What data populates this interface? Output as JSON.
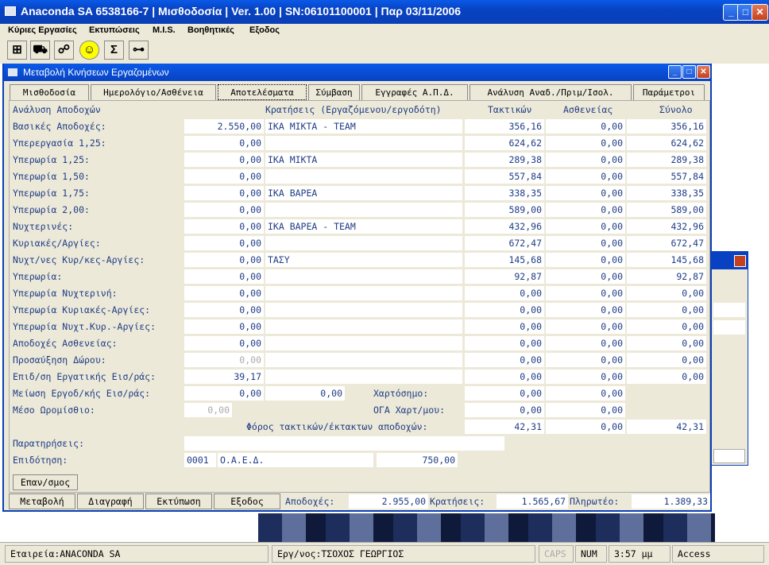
{
  "app": {
    "title": "Anaconda SA 6538166-7 | Μισθοδοσία | Ver. 1.00 | SN:06101100001 | Παρ 03/11/2006",
    "menu": [
      "Κύριες Εργασίες",
      "Εκτυπώσεις",
      "M.I.S.",
      "Βοηθητικές",
      "Εξοδος"
    ],
    "toolbar_icons": [
      "network-icon",
      "car-icon",
      "org-chart-icon",
      "smiley-icon",
      "sigma-icon",
      "key-icon"
    ],
    "toolbar_glyphs": [
      "⊞",
      "⛟",
      "☍",
      "☺",
      "Σ",
      "⊶"
    ]
  },
  "child": {
    "title": "Μεταβολή Κινήσεων Εργαζομένων",
    "tabs": [
      "Μισθοδοσία",
      "Ημερολόγιο/Ασθένεια",
      "Αποτελέσματα",
      "Σύμβαση",
      "Εγγραφές Α.Π.Δ.",
      "Ανάλυση Αναδ./Πριμ/Ισολ.",
      "Παράμετροι"
    ],
    "active_tab": "Αποτελέσματα",
    "headers": {
      "analysis": "Ανάλυση Αποδοχών",
      "deductions": "Κρατήσεις (Εργαζόμενου/εργοδότη)",
      "regular": "Τακτικών",
      "sickness": "Ασθενείας",
      "total": "Σύνολο"
    },
    "rows": [
      {
        "label": "Βασικές Αποδοχές:",
        "value": "2.550,00",
        "ded": "ΙΚΑ ΜΙΚΤΑ - TEAM",
        "reg": "356,16",
        "sick": "0,00",
        "tot": "356,16"
      },
      {
        "label": "Υπερεργασία 1,25:",
        "value": "0,00",
        "ded": "",
        "reg": "624,62",
        "sick": "0,00",
        "tot": "624,62"
      },
      {
        "label": "Υπερωρία 1,25:",
        "value": "0,00",
        "ded": "ΙΚΑ ΜΙΚΤΑ",
        "reg": "289,38",
        "sick": "0,00",
        "tot": "289,38"
      },
      {
        "label": "Υπερωρία 1,50:",
        "value": "0,00",
        "ded": "",
        "reg": "557,84",
        "sick": "0,00",
        "tot": "557,84"
      },
      {
        "label": "Υπερωρία 1,75:",
        "value": "0,00",
        "ded": "ΙΚΑ ΒΑΡΕΑ",
        "reg": "338,35",
        "sick": "0,00",
        "tot": "338,35"
      },
      {
        "label": "Υπερωρία 2,00:",
        "value": "0,00",
        "ded": "",
        "reg": "589,00",
        "sick": "0,00",
        "tot": "589,00"
      },
      {
        "label": "Νυχτερινές:",
        "value": "0,00",
        "ded": "ΙΚΑ ΒΑΡΕΑ - TEAM",
        "reg": "432,96",
        "sick": "0,00",
        "tot": "432,96"
      },
      {
        "label": "Κυριακές/Αργίες:",
        "value": "0,00",
        "ded": "",
        "reg": "672,47",
        "sick": "0,00",
        "tot": "672,47"
      },
      {
        "label": "Νυχτ/νες Κυρ/κες-Αργίες:",
        "value": "0,00",
        "ded": "ΤΑΣΥ",
        "reg": "145,68",
        "sick": "0,00",
        "tot": "145,68"
      },
      {
        "label": "Υπερωρία:",
        "value": "0,00",
        "ded": "",
        "reg": "92,87",
        "sick": "0,00",
        "tot": "92,87"
      },
      {
        "label": "Υπερωρία Νυχτερινή:",
        "value": "0,00",
        "ded": "",
        "reg": "0,00",
        "sick": "0,00",
        "tot": "0,00"
      },
      {
        "label": "Υπερωρία Κυριακές-Αργίες:",
        "value": "0,00",
        "ded": "",
        "reg": "0,00",
        "sick": "0,00",
        "tot": "0,00"
      },
      {
        "label": "Υπερωρία Νυχτ.Κυρ.-Αργίες:",
        "value": "0,00",
        "ded": "",
        "reg": "0,00",
        "sick": "0,00",
        "tot": "0,00"
      },
      {
        "label": "Αποδοχές Ασθενείας:",
        "value": "0,00",
        "ded": "",
        "reg": "0,00",
        "sick": "0,00",
        "tot": "0,00"
      },
      {
        "label": "Προσαύξηση Δώρου:",
        "value": "0,00",
        "ded": "",
        "reg": "0,00",
        "sick": "0,00",
        "tot": "0,00"
      },
      {
        "label": "Επιδ/ση Εργατικής Εισ/ράς:",
        "value": "39,17",
        "ded": "",
        "reg": "0,00",
        "sick": "0,00",
        "tot": "0,00"
      }
    ],
    "meiosi": {
      "label": "Μείωση Εργοδ/κής Εισ/ράς:",
      "value": "0,00",
      "value2": "0,00",
      "ded": "Χαρτόσημο:",
      "reg": "0,00",
      "sick": "0,00"
    },
    "meso": {
      "label": "Μέσο Ωρομίσθιο:",
      "value": "0,00",
      "ded": "ΟΓΑ Χαρτ/μου:",
      "reg": "0,00",
      "sick": "0,00"
    },
    "foros": {
      "label": "Φόρος τακτικών/έκτακτων αποδοχών:",
      "reg": "42,31",
      "sick": "0,00",
      "tot": "42,31"
    },
    "notes": {
      "label": "Παρατηρήσεις:",
      "value": ""
    },
    "subsidy": {
      "label": "Επιδότηση:",
      "code": "0001",
      "name": "Ο.Α.Ε.Δ.",
      "amount": "750,00"
    },
    "recalc_button": "Επαν/σμος",
    "bottom": {
      "buttons": [
        "Μεταβολή",
        "Διαγραφή",
        "Εκτύπωση",
        "Εξοδος"
      ],
      "earnings_label": "Αποδοχές:",
      "earnings": "2.955,00",
      "deductions_label": "Κρατήσεις:",
      "deductions": "1.565,67",
      "payable_label": "Πληρωτέο:",
      "payable": "1.389,33"
    }
  },
  "status": {
    "company": "Εταιρεία:ANACONDA SA",
    "employee": "Εργ/νος:ΤΣΟΧΟΣ ΓΕΩΡΓΙΟΣ",
    "caps": "CAPS",
    "num": "NUM",
    "time": "3:57 μμ",
    "db": "Access"
  }
}
